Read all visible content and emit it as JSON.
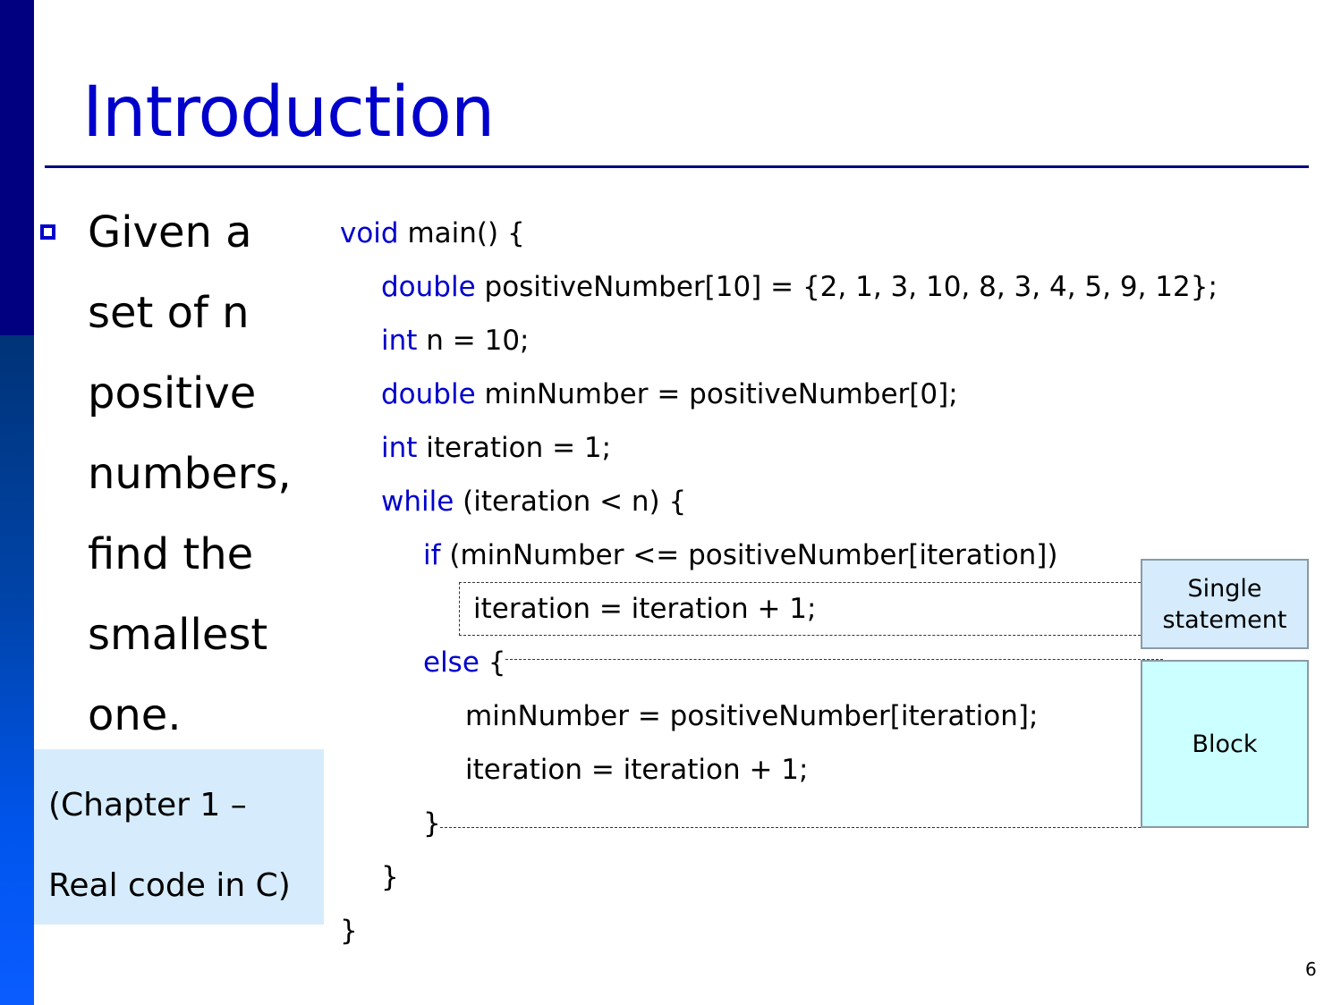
{
  "slide": {
    "title": "Introduction",
    "page_number": "6",
    "colors": {
      "title": "#0000cc",
      "keyword": "#0000cc",
      "sidebar_top": "#000080",
      "note_background": "#d6ecfc",
      "single_statement_background": "#d6ecfc",
      "block_background": "#ccffff"
    }
  },
  "bullet": {
    "icon": "hollow-square-bullet-icon",
    "lines": [
      "Given a",
      "set of n",
      "positive",
      "numbers,",
      "find the",
      "smallest",
      "one."
    ]
  },
  "note": {
    "lines": [
      "(Chapter 1 –",
      "Real code in C)"
    ]
  },
  "code": {
    "lines": [
      {
        "kw": "void",
        "rest": " main() {"
      },
      {
        "kw": "double",
        "rest": " positiveNumber[10] = {2, 1, 3, 10, 8, 3, 4, 5, 9, 12};"
      },
      {
        "kw": "int",
        "rest": " n = 10;"
      },
      {
        "kw": "double",
        "rest": " minNumber = positiveNumber[0];"
      },
      {
        "kw": "int",
        "rest": " iteration = 1;"
      },
      {
        "kw": "while",
        "rest": " (iteration < n) {"
      },
      {
        "kw": "if",
        "rest": " (minNumber <= positiveNumber[iteration])"
      },
      {
        "kw": "",
        "rest": "iteration = iteration + 1;"
      },
      {
        "kw": "else",
        "rest": " {"
      },
      {
        "kw": "",
        "rest": "minNumber = positiveNumber[iteration];"
      },
      {
        "kw": "",
        "rest": "iteration = iteration + 1;"
      },
      {
        "kw": "",
        "rest": "}"
      },
      {
        "kw": "",
        "rest": "}"
      },
      {
        "kw": "",
        "rest": "}"
      }
    ]
  },
  "annotations": {
    "single_statement": "Single statement",
    "single_statement_line1": "Single",
    "single_statement_line2": "statement",
    "block": "Block"
  }
}
